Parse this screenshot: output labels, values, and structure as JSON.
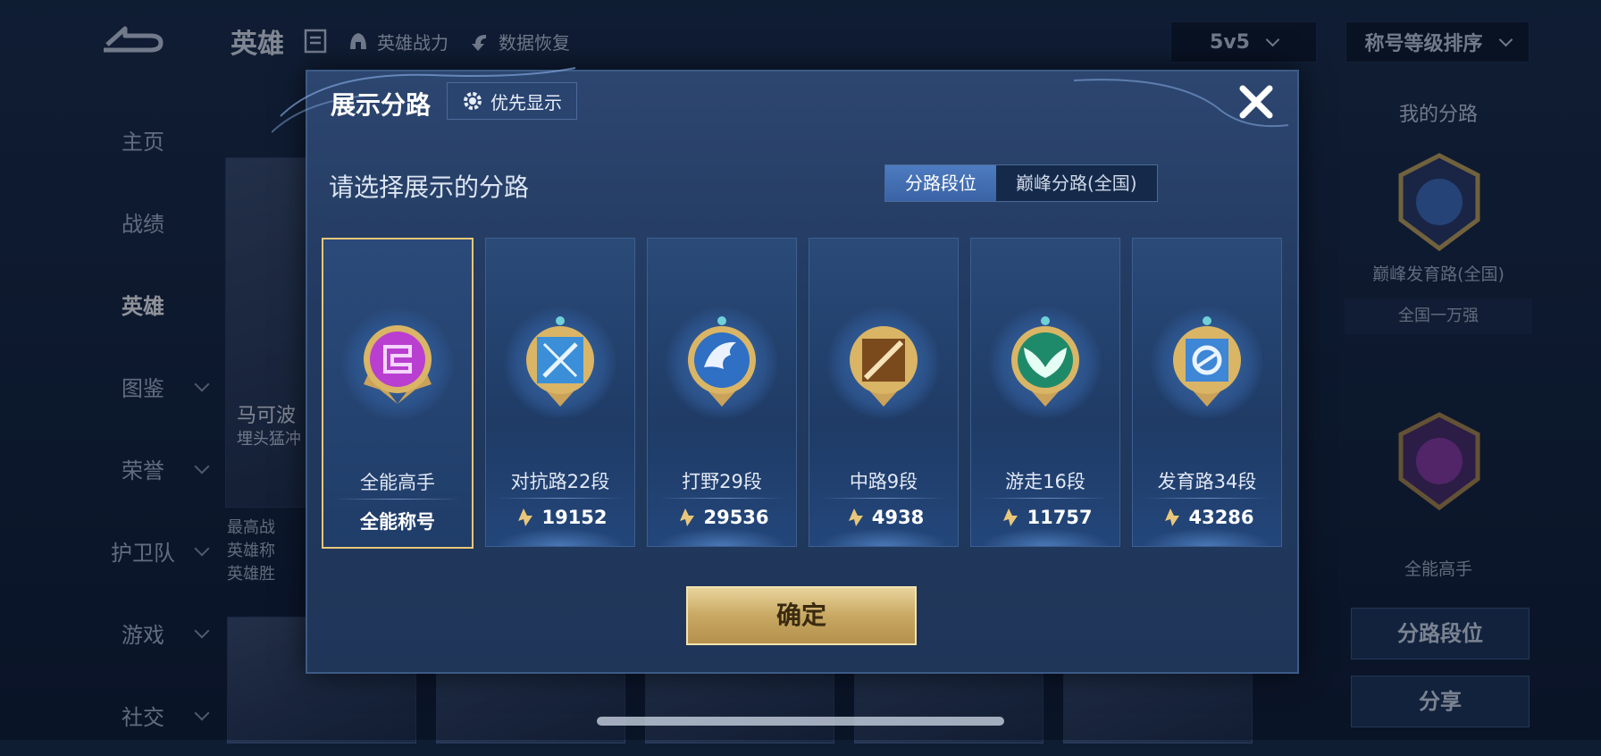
{
  "background": {
    "page_title": "英雄",
    "topbar_items": [
      "英雄战力",
      "数据恢复"
    ],
    "mode_select": "5v5",
    "sort_select": "称号等级排序",
    "nav": [
      "主页",
      "战绩",
      "英雄",
      "图鉴",
      "荣誉",
      "护卫队",
      "游戏",
      "社交"
    ],
    "nav_active": "英雄",
    "hero_name": "马可波",
    "hero_sub": "埋头猛冲",
    "hero_info": [
      "最高战",
      "英雄称",
      "英雄胜"
    ],
    "right_title": "我的分路",
    "right_badge_label": "巅峰发育路(全国)",
    "right_rank": "全国一万强",
    "right_label2": "全能高手",
    "right_btn1": "分路段位",
    "right_btn2": "分享"
  },
  "modal": {
    "title": "展示分路",
    "priority_button": "优先显示",
    "prompt": "请选择展示的分路",
    "tabs": [
      "分路段位",
      "巅峰分路(全国)"
    ],
    "active_tab": "分路段位",
    "cards": [
      {
        "name": "全能高手",
        "score": "全能称号",
        "badge": "allround-badge-icon",
        "selected": true,
        "color": "#b93fd0"
      },
      {
        "name": "对抗路22段",
        "score": "19152",
        "badge": "clash-lane-badge-icon",
        "selected": false,
        "color": "#3b8fd8"
      },
      {
        "name": "打野29段",
        "score": "29536",
        "badge": "jungle-badge-icon",
        "selected": false,
        "color": "#2f6fc4"
      },
      {
        "name": "中路9段",
        "score": "4938",
        "badge": "mid-lane-badge-icon",
        "selected": false,
        "color": "#7a4a1c"
      },
      {
        "name": "游走16段",
        "score": "11757",
        "badge": "roam-badge-icon",
        "selected": false,
        "color": "#1f8a6a"
      },
      {
        "name": "发育路34段",
        "score": "43286",
        "badge": "farm-lane-badge-icon",
        "selected": false,
        "color": "#3e86d6"
      }
    ],
    "confirm": "确定"
  },
  "colors": {
    "accent_gold": "#e8c77a",
    "selected_tab": "#4e7cc0"
  }
}
